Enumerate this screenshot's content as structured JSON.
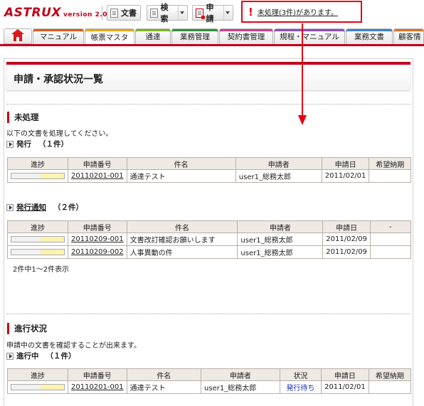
{
  "app": {
    "logo": "ASTRUX",
    "version": "version 2.0"
  },
  "toolbar": {
    "documents": "文書",
    "search": "検索",
    "application": "申請"
  },
  "alert": {
    "message": "未処理(3件)があります。"
  },
  "tabs": [
    "マニュアル",
    "帳票マスタ",
    "通達",
    "業務管理",
    "契約書管理",
    "規程・マニュアル",
    "業務文書",
    "顧客情"
  ],
  "tab_colors": [
    "#e05a1c",
    "#f0a500",
    "#7ab51d",
    "#2f8f3a",
    "#d23b8a",
    "#8a4bc8",
    "#3b82d6",
    "#e07020"
  ],
  "page": {
    "title": "申請・承認状況一覧"
  },
  "unprocessed": {
    "heading": "未処理",
    "note": "以下の文書を処理してください。",
    "issue": {
      "label": "発行",
      "count": "（１件）",
      "headers": [
        "進捗",
        "申請番号",
        "件名",
        "申請者",
        "申請日",
        "希望納期"
      ],
      "rows": [
        {
          "progress": 0.45,
          "number": "20110201-001",
          "subject": "通達テスト",
          "applicant": "user1_総務太郎",
          "date": "2011/02/01",
          "due": ""
        }
      ]
    },
    "notice": {
      "label": "発行通知",
      "count": "（２件）",
      "headers": [
        "進捗",
        "申請番号",
        "件名",
        "申請者",
        "申請日",
        "-"
      ],
      "rows": [
        {
          "progress": 0.45,
          "number": "20110209-001",
          "subject": "文書改訂確認お願いします",
          "applicant": "user1_総務太郎",
          "date": "2011/02/09",
          "due": ""
        },
        {
          "progress": 0.45,
          "number": "20110209-002",
          "subject": "人事異動の件",
          "applicant": "user1_総務太郎",
          "date": "2011/02/09",
          "due": ""
        }
      ],
      "pager": "2件中1～2件表示"
    }
  },
  "progress_section": {
    "heading": "進行状況",
    "note": "申請中の文書を確認することが出来ます。",
    "in_progress": {
      "label": "進行中",
      "count": "（１件）",
      "headers": [
        "進捗",
        "申請番号",
        "件名",
        "申請者",
        "状況",
        "申請日",
        "希望納期"
      ],
      "rows": [
        {
          "progress": 0.45,
          "number": "20110201-001",
          "subject": "通達テスト",
          "applicant": "user1_総務太郎",
          "status": "発行待ち",
          "date": "2011/02/01",
          "due": ""
        }
      ]
    }
  }
}
